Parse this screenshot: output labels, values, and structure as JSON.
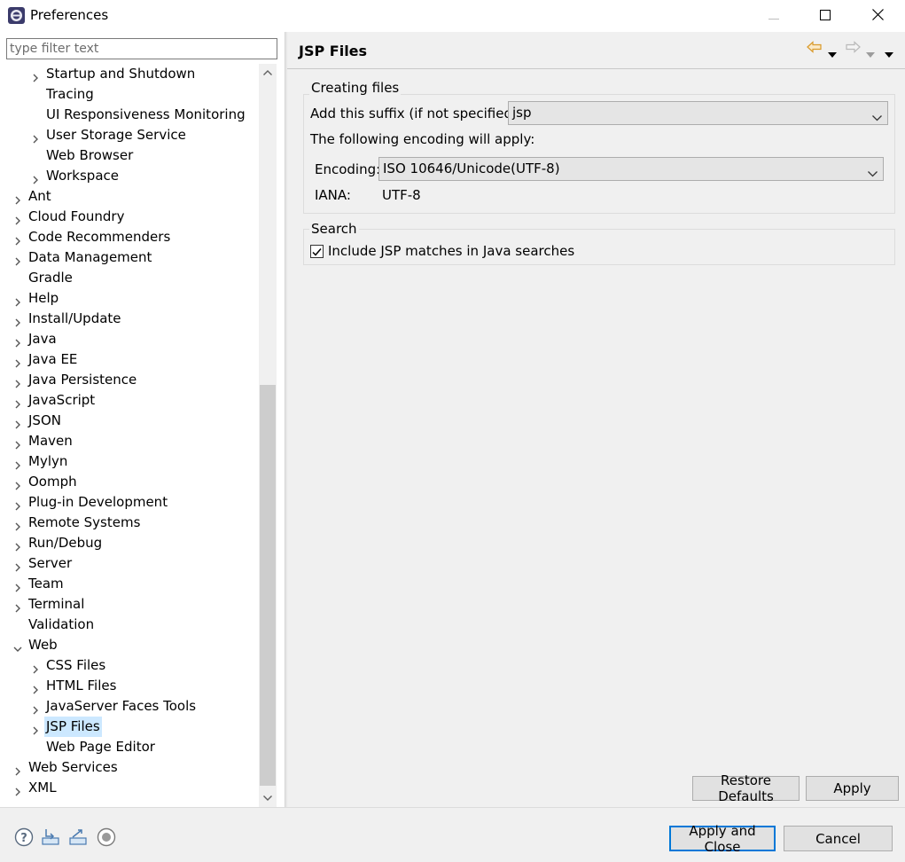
{
  "window": {
    "title": "Preferences"
  },
  "filter": {
    "placeholder": "type filter text"
  },
  "tree": [
    {
      "label": "Startup and Shutdown",
      "level": 1,
      "expandable": true
    },
    {
      "label": "Tracing",
      "level": 1,
      "expandable": false
    },
    {
      "label": "UI Responsiveness Monitoring",
      "level": 1,
      "expandable": false
    },
    {
      "label": "User Storage Service",
      "level": 1,
      "expandable": true
    },
    {
      "label": "Web Browser",
      "level": 1,
      "expandable": false
    },
    {
      "label": "Workspace",
      "level": 1,
      "expandable": true
    },
    {
      "label": "Ant",
      "level": 0,
      "expandable": true
    },
    {
      "label": "Cloud Foundry",
      "level": 0,
      "expandable": true
    },
    {
      "label": "Code Recommenders",
      "level": 0,
      "expandable": true
    },
    {
      "label": "Data Management",
      "level": 0,
      "expandable": true
    },
    {
      "label": "Gradle",
      "level": 0,
      "expandable": false
    },
    {
      "label": "Help",
      "level": 0,
      "expandable": true
    },
    {
      "label": "Install/Update",
      "level": 0,
      "expandable": true
    },
    {
      "label": "Java",
      "level": 0,
      "expandable": true
    },
    {
      "label": "Java EE",
      "level": 0,
      "expandable": true
    },
    {
      "label": "Java Persistence",
      "level": 0,
      "expandable": true
    },
    {
      "label": "JavaScript",
      "level": 0,
      "expandable": true
    },
    {
      "label": "JSON",
      "level": 0,
      "expandable": true
    },
    {
      "label": "Maven",
      "level": 0,
      "expandable": true
    },
    {
      "label": "Mylyn",
      "level": 0,
      "expandable": true
    },
    {
      "label": "Oomph",
      "level": 0,
      "expandable": true
    },
    {
      "label": "Plug-in Development",
      "level": 0,
      "expandable": true
    },
    {
      "label": "Remote Systems",
      "level": 0,
      "expandable": true
    },
    {
      "label": "Run/Debug",
      "level": 0,
      "expandable": true
    },
    {
      "label": "Server",
      "level": 0,
      "expandable": true
    },
    {
      "label": "Team",
      "level": 0,
      "expandable": true
    },
    {
      "label": "Terminal",
      "level": 0,
      "expandable": true
    },
    {
      "label": "Validation",
      "level": 0,
      "expandable": false
    },
    {
      "label": "Web",
      "level": 0,
      "expandable": true,
      "expanded": true
    },
    {
      "label": "CSS Files",
      "level": 1,
      "expandable": true
    },
    {
      "label": "HTML Files",
      "level": 1,
      "expandable": true
    },
    {
      "label": "JavaServer Faces Tools",
      "level": 1,
      "expandable": true
    },
    {
      "label": "JSP Files",
      "level": 1,
      "expandable": true,
      "selected": true
    },
    {
      "label": "Web Page Editor",
      "level": 1,
      "expandable": false
    },
    {
      "label": "Web Services",
      "level": 0,
      "expandable": true
    },
    {
      "label": "XML",
      "level": 0,
      "expandable": true
    }
  ],
  "page": {
    "title": "JSP Files",
    "creating_files": {
      "group_title": "Creating files",
      "suffix_label": "Add this suffix (if not specified):",
      "suffix_value": "jsp",
      "encoding_intro": "The following encoding will apply:",
      "encoding_label": "Encoding:",
      "encoding_value": "ISO 10646/Unicode(UTF-8)",
      "iana_label": "IANA:",
      "iana_value": "UTF-8"
    },
    "search": {
      "group_title": "Search",
      "checkbox_label": "Include JSP matches in Java searches",
      "checked": true
    },
    "restore_defaults": "Restore Defaults",
    "apply": "Apply"
  },
  "footer": {
    "apply_and_close": "Apply and Close",
    "cancel": "Cancel"
  },
  "colors": {
    "selection": "#cce8ff",
    "default_button_border": "#0078d7",
    "nav_back_arrow": "#e8a33c"
  }
}
